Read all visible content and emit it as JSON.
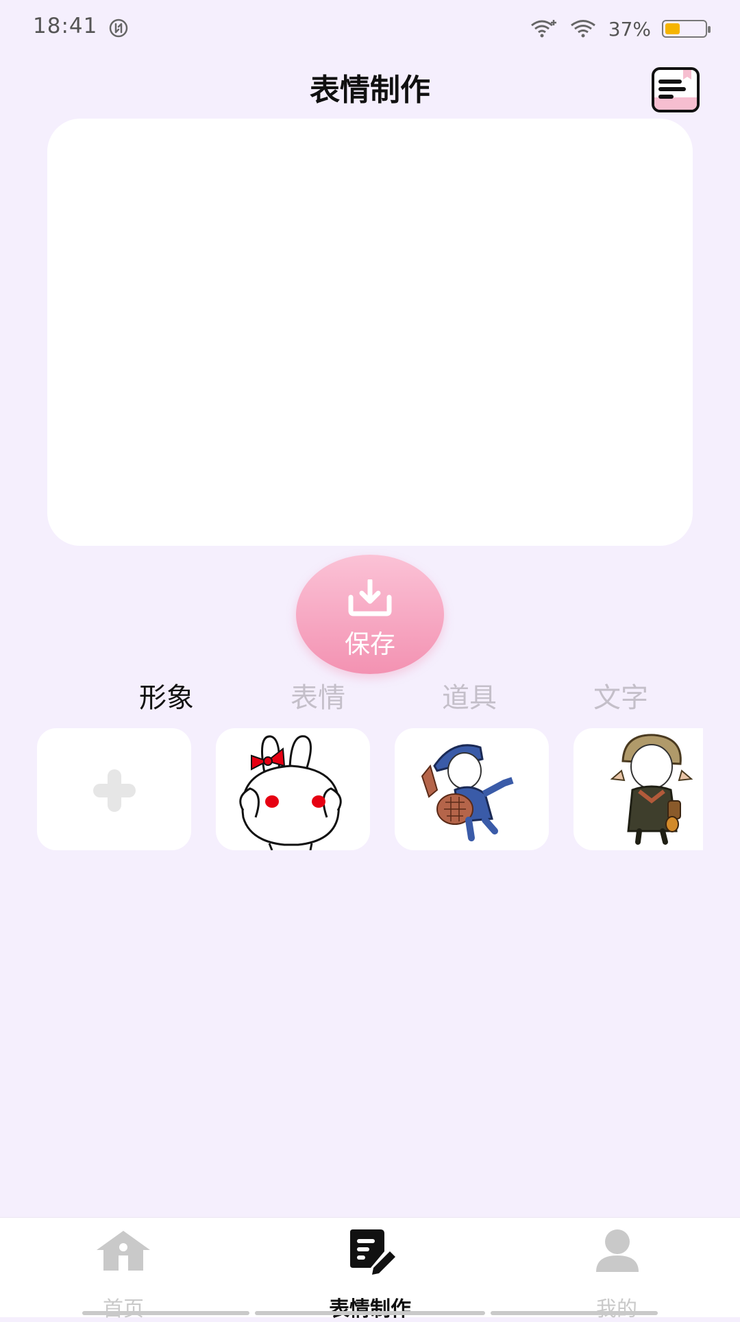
{
  "status_bar": {
    "time": "18:41",
    "battery_percent": "37%",
    "battery_level": 0.37
  },
  "header": {
    "title": "表情制作"
  },
  "save": {
    "label": "保存"
  },
  "tabs": [
    {
      "label": "形象",
      "active": true
    },
    {
      "label": "表情",
      "active": false
    },
    {
      "label": "道具",
      "active": false
    },
    {
      "label": "文字",
      "active": false
    }
  ],
  "items": [
    {
      "name": "add-item",
      "icon": "plus-icon"
    },
    {
      "name": "bunny-sticker",
      "icon": "bunny-red-bow"
    },
    {
      "name": "blue-hat-character",
      "icon": "character-blue-hat"
    },
    {
      "name": "explorer-character",
      "icon": "character-explorer"
    }
  ],
  "bottom_nav": [
    {
      "label": "首页",
      "icon": "home-icon",
      "active": false
    },
    {
      "label": "表情制作",
      "icon": "edit-document-icon",
      "active": true
    },
    {
      "label": "我的",
      "icon": "user-icon",
      "active": false
    }
  ],
  "colors": {
    "background": "#f5effd",
    "accent_pink": "#f392b2",
    "inactive": "#c4bfc9"
  }
}
